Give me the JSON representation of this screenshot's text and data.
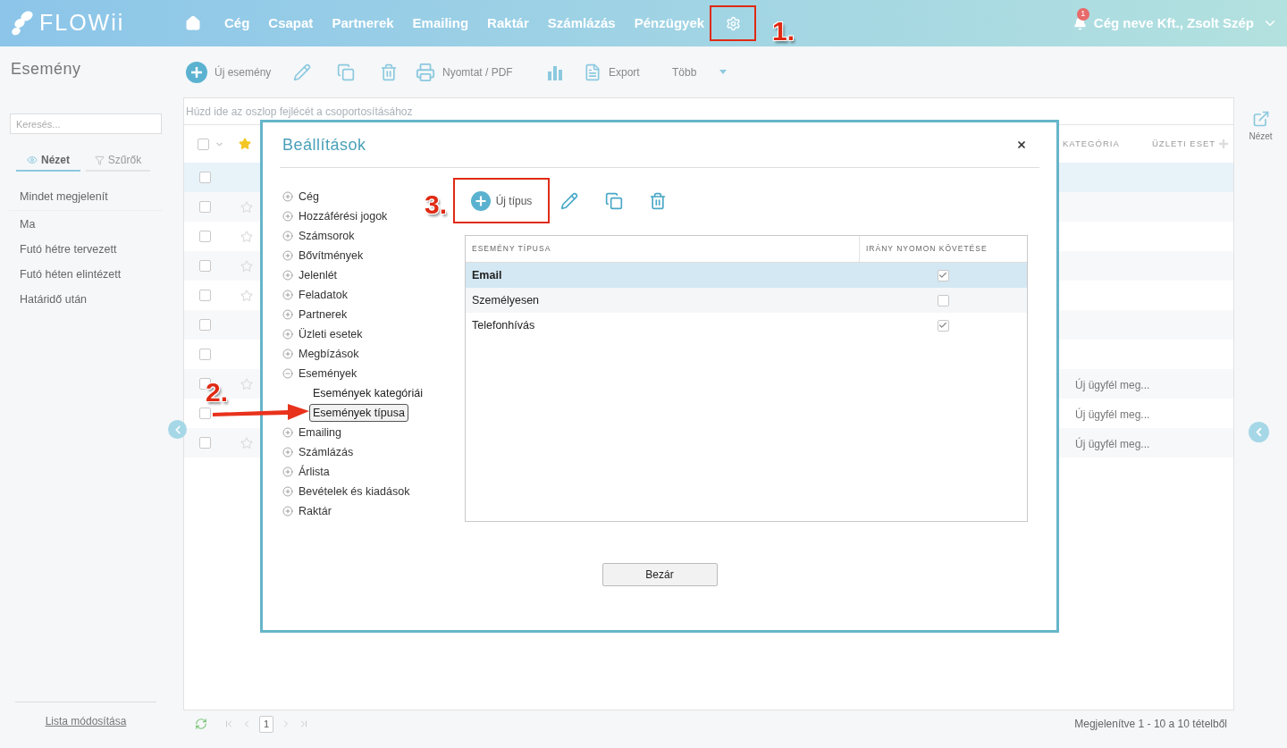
{
  "header": {
    "logo": "FLOWii",
    "nav": [
      "Cég",
      "Csapat",
      "Partnerek",
      "Emailing",
      "Raktár",
      "Számlázás",
      "Pénzügyek"
    ],
    "notification_count": "1",
    "user": "Cég neve Kft., Zsolt Szép"
  },
  "sidebar": {
    "title": "Esemény",
    "search": {
      "placeholder": "Keresés..."
    },
    "tabs": [
      {
        "label": "Nézet",
        "selected": true
      },
      {
        "label": "Szűrők",
        "selected": false
      }
    ],
    "items": [
      "Mindet megjelenít",
      "Ma",
      "Futó hétre tervezett",
      "Futó héten elintézett",
      "Határidő után"
    ],
    "footer_link": "Lista módosítása"
  },
  "toolbar": [
    {
      "kind": "add",
      "label": "Új esemény"
    },
    {
      "kind": "edit"
    },
    {
      "kind": "copy"
    },
    {
      "kind": "delete"
    },
    {
      "kind": "print",
      "label": "Nyomtat / PDF"
    },
    {
      "kind": "chart"
    },
    {
      "kind": "export",
      "label": "Export"
    },
    {
      "kind": "more",
      "label": "Több"
    }
  ],
  "grid": {
    "select_all_checked": false,
    "group_hint": "Húzd ide az oszlop fejlécét a csoportosításához",
    "columns": [
      "KATEGÓRIA",
      "ÜZLETI ESET"
    ],
    "rows": [
      {
        "selected": true,
        "has_star": false
      },
      {
        "selected": false,
        "has_star": true
      },
      {
        "selected": false,
        "has_star": true
      },
      {
        "selected": false,
        "has_star": true
      },
      {
        "selected": false,
        "has_star": true
      },
      {
        "selected": false,
        "has_star": false
      },
      {
        "selected": false,
        "has_star": false
      },
      {
        "selected": false,
        "has_star": true,
        "category": "Új ügyfél meg..."
      },
      {
        "selected": false,
        "has_star": false,
        "category": "Új ügyfél meg..."
      },
      {
        "selected": false,
        "has_star": true,
        "category": "Új ügyfél meg..."
      }
    ]
  },
  "view_button": "Nézet",
  "pager": {
    "page": "1",
    "summary": "Megjelenítve 1 - 10 a 10 tételből"
  },
  "modal": {
    "title": "Beállítások",
    "tree": [
      {
        "label": "Cég",
        "expanded": false
      },
      {
        "label": "Hozzáférési jogok",
        "expanded": false
      },
      {
        "label": "Számsorok",
        "expanded": false
      },
      {
        "label": "Bővítmények",
        "expanded": false
      },
      {
        "label": "Jelenlét",
        "expanded": false
      },
      {
        "label": "Feladatok",
        "expanded": false
      },
      {
        "label": "Partnerek",
        "expanded": false
      },
      {
        "label": "Üzleti esetek",
        "expanded": false
      },
      {
        "label": "Megbízások",
        "expanded": false
      },
      {
        "label": "Események",
        "expanded": true,
        "children": [
          {
            "label": "Események kategóriái",
            "selected": false
          },
          {
            "label": "Események típusa",
            "selected": true
          }
        ]
      },
      {
        "label": "Emailing",
        "expanded": false
      },
      {
        "label": "Számlázás",
        "expanded": false
      },
      {
        "label": "Árlista",
        "expanded": false
      },
      {
        "label": "Bevételek és kiadások",
        "expanded": false
      },
      {
        "label": "Raktár",
        "expanded": false
      }
    ],
    "add_button": "Új típus",
    "table": {
      "columns": [
        "ESEMÉNY TÍPUSA",
        "IRÁNY NYOMON KÖVETÉSE"
      ],
      "rows": [
        {
          "name": "Email",
          "tracked": true,
          "selected": true
        },
        {
          "name": "Személyesen",
          "tracked": false,
          "selected": false
        },
        {
          "name": "Telefonhívás",
          "tracked": true,
          "selected": false
        }
      ]
    },
    "close_button": "Bezár"
  },
  "annotations": [
    "1.",
    "2.",
    "3."
  ]
}
